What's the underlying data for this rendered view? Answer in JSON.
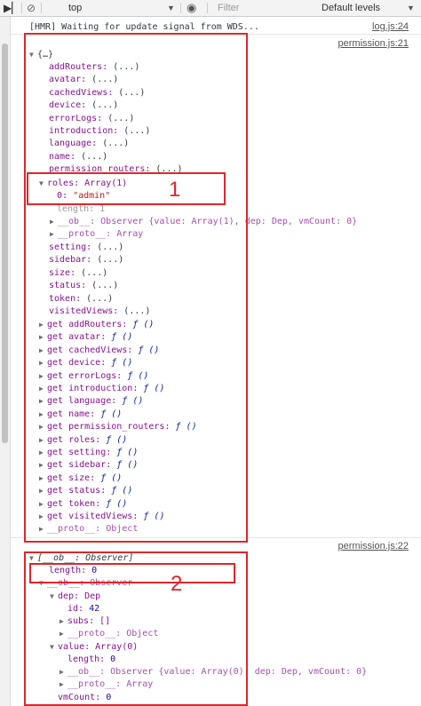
{
  "toolbar": {
    "context": "top",
    "filter_placeholder": "Filter",
    "levels": "Default levels"
  },
  "console": {
    "hmr_message": "[HMR] Waiting for update signal from WDS...",
    "hmr_source": "log.js:24",
    "entry1_source": "permission.js:21",
    "entry1_header": "{…}",
    "entry1_props": [
      "addRouters: (...)",
      "avatar: (...)",
      "cachedViews: (...)",
      "device: (...)",
      "errorLogs: (...)",
      "introduction: (...)",
      "language: (...)",
      "name: (...)",
      "permission_routers: (...)"
    ],
    "roles_header": "roles: Array(1)",
    "roles_item": "0: \"admin\"",
    "roles_length": "length: 1",
    "roles_ob": "__ob__: Observer {value: Array(1), dep: Dep, vmCount: 0}",
    "roles_proto": "__proto__: Array",
    "entry1_props2": [
      "setting: (...)",
      "sidebar: (...)",
      "size: (...)",
      "status: (...)",
      "token: (...)",
      "visitedViews: (...)"
    ],
    "entry1_getters": [
      "get addRouters: ƒ ()",
      "get avatar: ƒ ()",
      "get cachedViews: ƒ ()",
      "get device: ƒ ()",
      "get errorLogs: ƒ ()",
      "get introduction: ƒ ()",
      "get language: ƒ ()",
      "get name: ƒ ()",
      "get permission_routers: ƒ ()",
      "get roles: ƒ ()",
      "get setting: ƒ ()",
      "get sidebar: ƒ ()",
      "get size: ƒ ()",
      "get status: ƒ ()",
      "get token: ƒ ()",
      "get visitedViews: ƒ ()"
    ],
    "entry1_proto": "__proto__: Object",
    "entry2_source": "permission.js:22",
    "entry2_header": "[__ob__: Observer]",
    "entry2_length": "length: 0",
    "entry2_ob": "__ob__: Observer",
    "entry2_dep": "dep: Dep",
    "entry2_id": "id: 42",
    "entry2_subs": "subs: []",
    "entry2_dep_proto": "__proto__: Object",
    "entry2_value": "value: Array(0)",
    "entry2_value_length": "length: 0",
    "entry2_value_ob": "__ob__: Observer {value: Array(0), dep: Dep, vmCount: 0}",
    "entry2_value_proto": "__proto__: Array",
    "entry2_vmcount": "vmCount: 0"
  },
  "annotations": {
    "label1": "1",
    "label2": "2"
  },
  "colors": {
    "annotation": "#e0262a"
  }
}
